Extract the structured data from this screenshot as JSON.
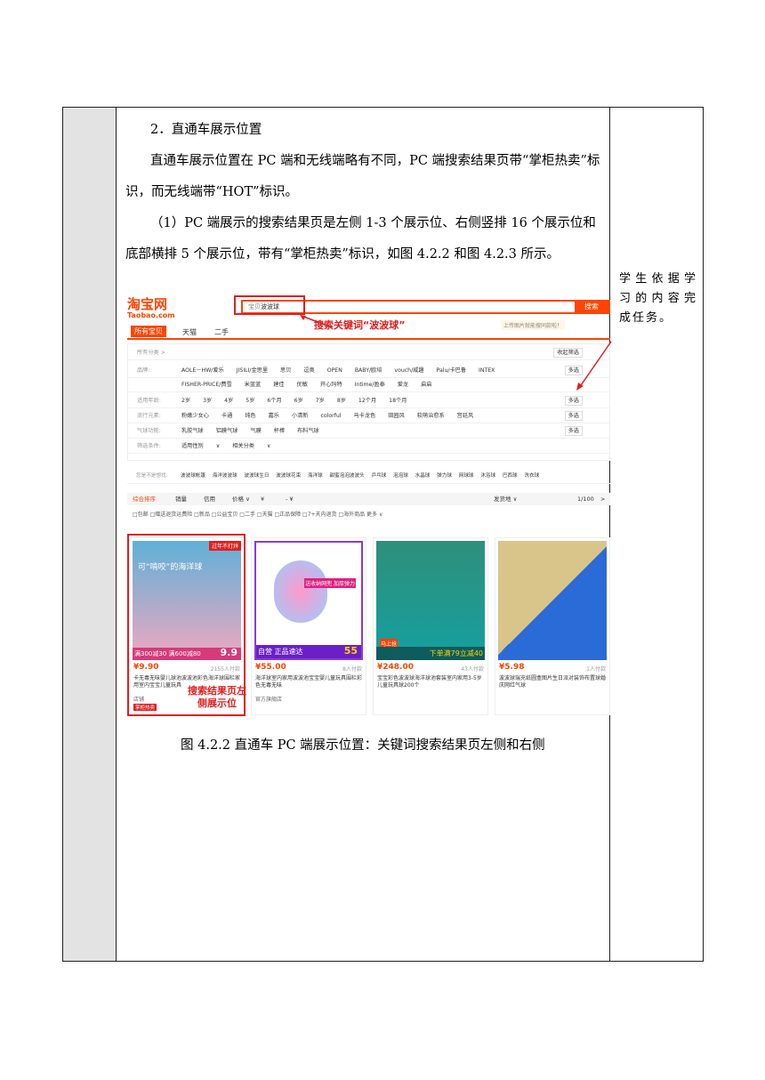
{
  "section_heading": "2．直通车展示位置",
  "para1": "直通车展示位置在 PC 端和无线端略有不同，PC 端搜索结果页带“掌柜热卖”标识，而无线端带“HOT”标识。",
  "para2": "（1）PC 端展示的搜索结果页是左侧 1-3 个展示位、右侧竖排 16 个展示位和底部横排 5 个展示位，带有“掌柜热卖”标识，如图 4.2.2 和图 4.2.3 所示。",
  "side_note": "学生依据学习的内容完成任务。",
  "screenshot": {
    "logo": "淘宝网",
    "logo_sub": "Taobao.com",
    "search_category": "宝贝",
    "search_query": "波波球",
    "search_button": "搜索",
    "annotation_search": "搜索关键词“波波球”",
    "image_search_hint": "上传图片就能搜同款啦！",
    "tabs": [
      "所有宝贝",
      "天猫",
      "二手"
    ],
    "filter_rows": [
      {
        "label": "所有分类 >",
        "options": "",
        "button": "收起筛选"
      },
      {
        "label": "品牌:",
        "options": "AOLE－HW/爱乐  JISILI/金思里  思贝  逗奥  OPEN BABY/欧培  vouch/威趣  Palu/卡巴鲁  INTEX",
        "button": "多选"
      },
      {
        "label": "",
        "options": "FISHER-PRICE/费雪  米蓝蓝  建佳  优敏  开心玛特  Intime/盈泰  爱龙  启启",
        "button": ""
      },
      {
        "label": "适用年龄:",
        "options": "2岁  3岁  4岁  5岁  6个月  6岁  7岁  8岁  12个月  18个月",
        "button": "多选"
      },
      {
        "label": "流行元素:",
        "options": "粉嫩少女心  卡通  纯色  嘉乐  小清新  colorful  马卡龙色  田园风  软萌治愈系  宫廷风",
        "button": "多选"
      },
      {
        "label": "气球功能:",
        "options": "乳胶气球  铝膜气球  气膜  杯棒  布料气球",
        "button": "多选"
      },
      {
        "label": "筛选条件:",
        "options": "适用性别 ∨   相关分类 ∨",
        "button": ""
      },
      {
        "label": "您是不是想找:",
        "options": "波波球帐篷  海洋波波球  波波球生日  波波球花束  海洋球  甜蜜泡泡波波头  乒乓球  泡泡球  水晶球  弹力球  网球球  沐浴球  巴西球  洗衣球",
        "button": ""
      }
    ],
    "sort_items": [
      "综合排序",
      "销量",
      "信用",
      "价格 ∨",
      "¥",
      "- ¥",
      "发货地 ∨",
      "1/100",
      ">"
    ],
    "options_row": "□包邮 □赠送退货运费险 □新品 □公益宝贝 □二手 □天猫 □正品保障 □7+天内退货 □海外商品   更多 ∨",
    "products": [
      {
        "price": "¥9.90",
        "sold": "2155人付款",
        "title": "卡无毒无味婴儿球池波波池彩色海洋球围栏家用室内宝宝儿童玩具",
        "shop": "店铺",
        "badge": "过年不打烊",
        "promo": "满300减30 满600减80",
        "promo_price": "9.9",
        "img_text": "可“啃咬”的海洋球"
      },
      {
        "price": "¥55.00",
        "sold": "8人付款",
        "title": "海洋球室内家用波波池宝宝婴儿童玩具围栏彩色无毒无味",
        "shop": "官方旗舰店",
        "badge": "",
        "promo": "自营 正品速达",
        "promo_price": "55",
        "img_text": "送收纳网兜 加厚弹力"
      },
      {
        "price": "¥248.00",
        "sold": "43人付款",
        "title": "宝宝彩色波波球海洋球池套装室内家用3-5岁儿童玩具球200个",
        "shop": "",
        "badge": "",
        "promo": "下单满79立减40",
        "promo_price": "",
        "img_text": "马上抢"
      },
      {
        "price": "¥5.98",
        "sold": "1人付款",
        "title": "波波球瑞充纸圆盒图片生日派对装饰布置球婚庆网红气球",
        "shop": "",
        "badge": "",
        "promo": "",
        "promo_price": "",
        "img_text": ""
      }
    ],
    "annotation_left": "搜索结果页左侧展示位",
    "hot_label": "掌柜热卖"
  },
  "caption": "图 4.2.2  直通车 PC 端展示位置：关键词搜索结果页左侧和右侧"
}
